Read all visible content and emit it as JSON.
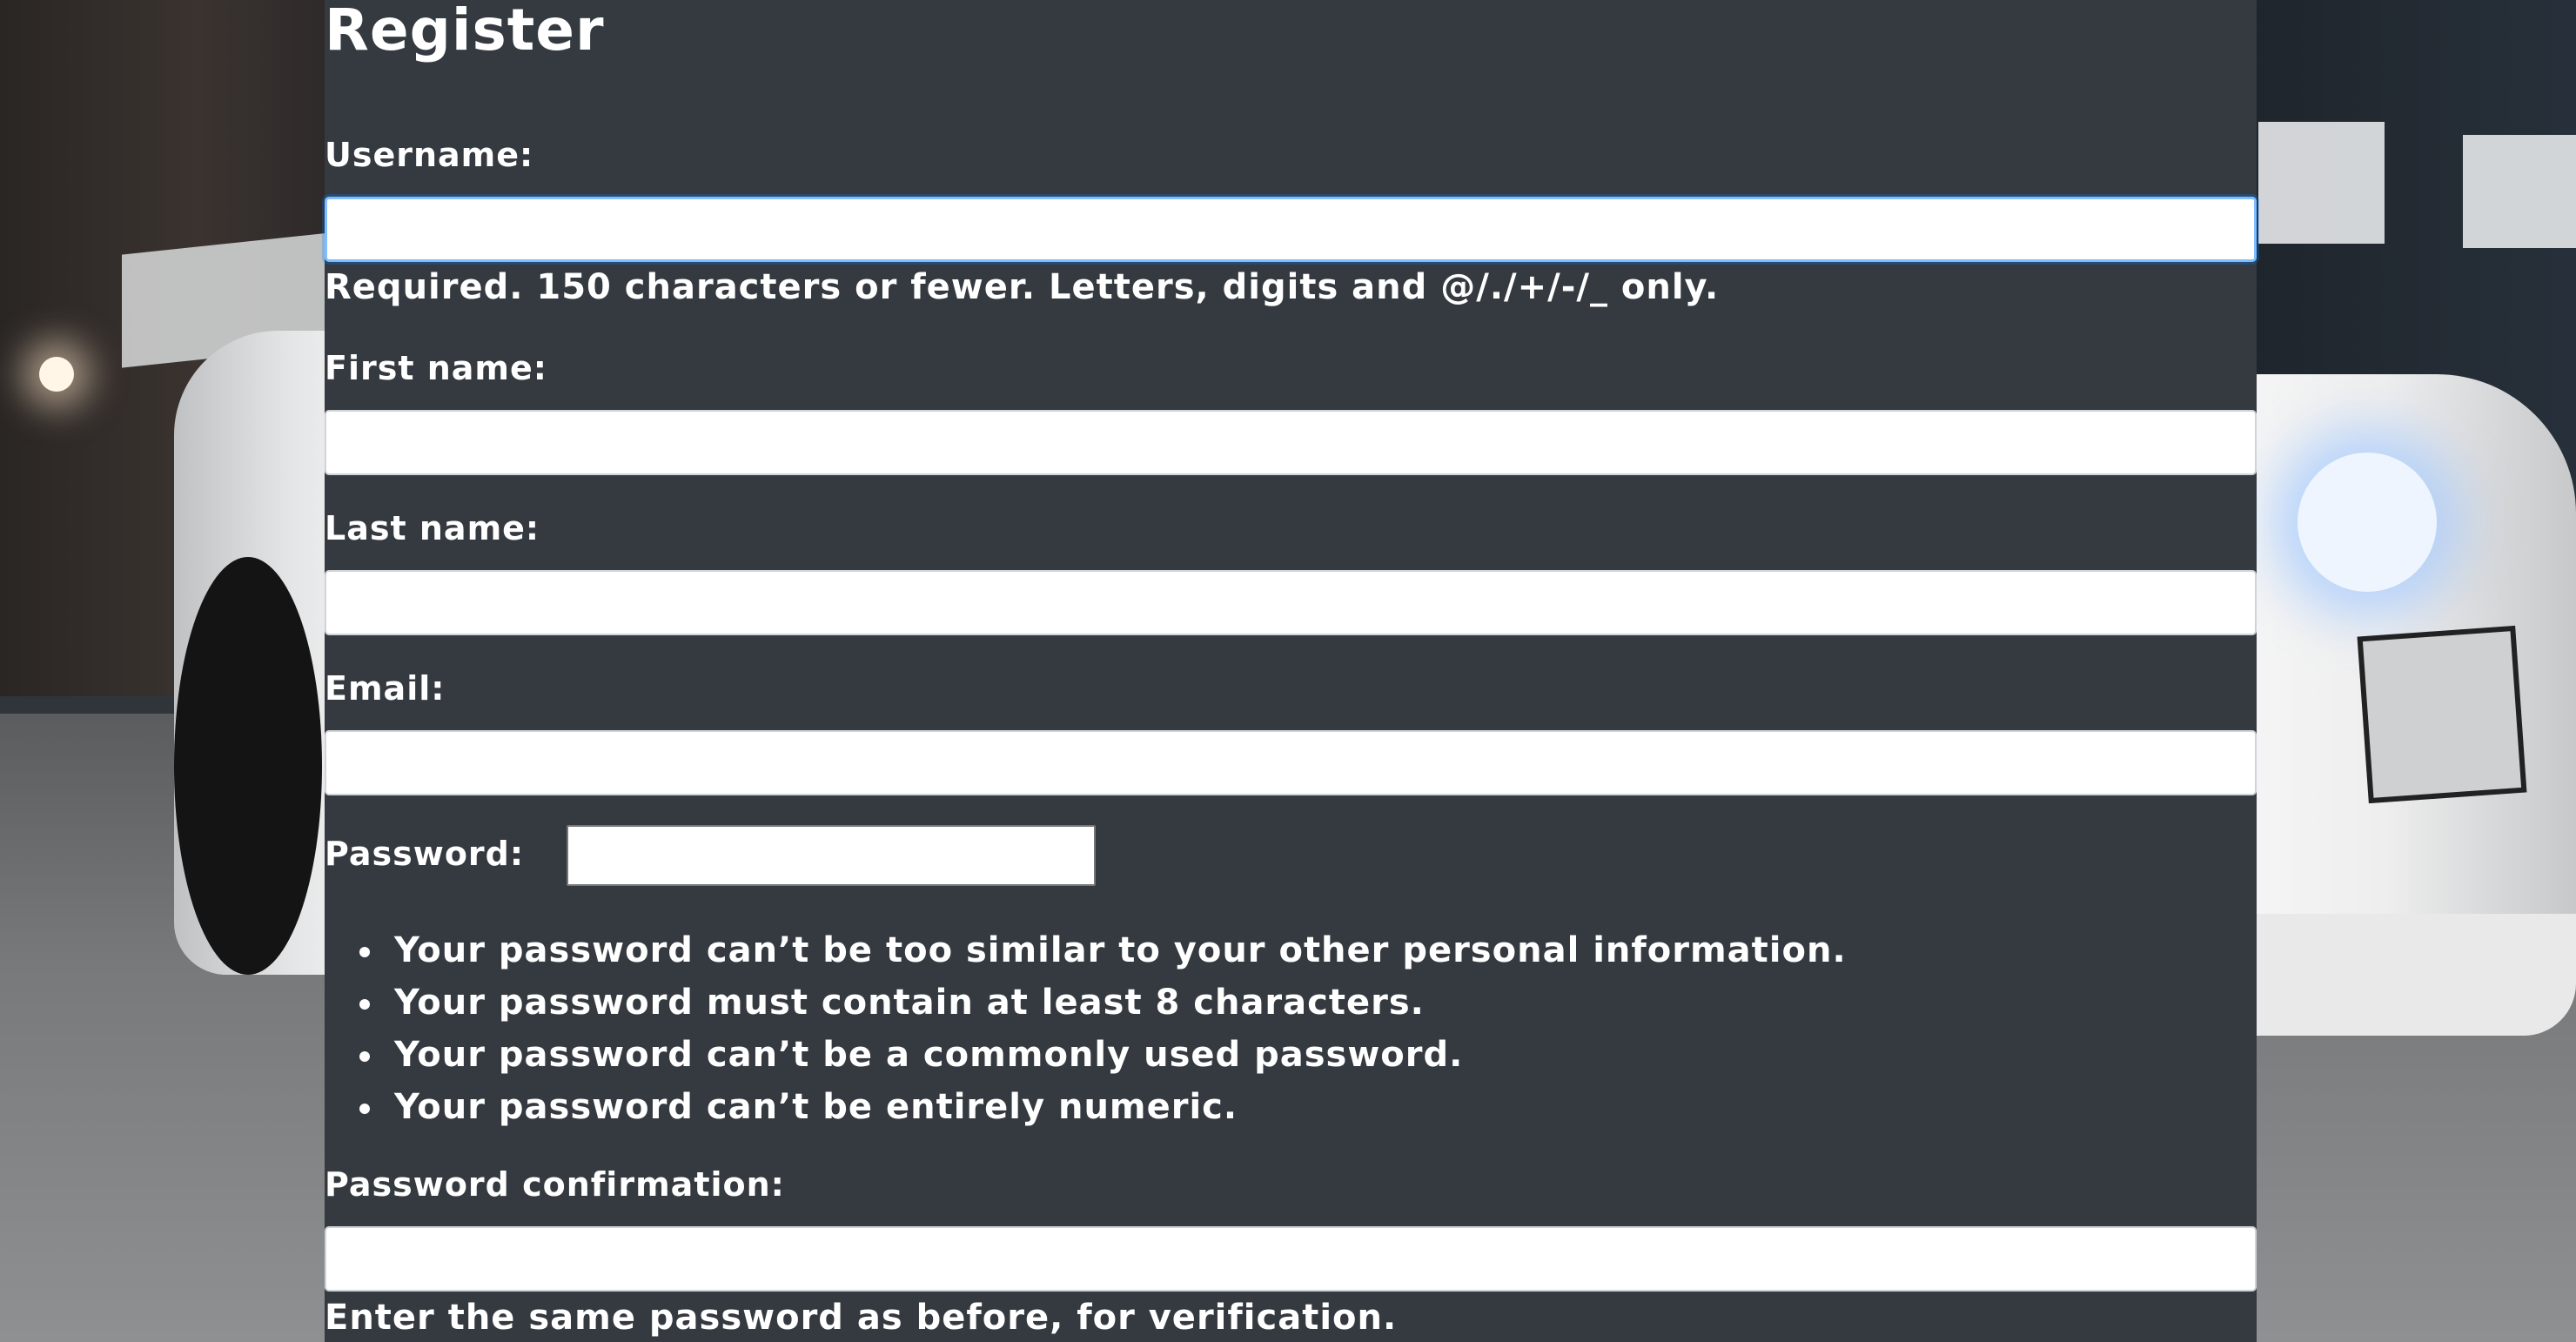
{
  "form": {
    "title": "Register",
    "username": {
      "label": "Username:",
      "value": "",
      "help": "Required. 150 characters or fewer. Letters, digits and @/./+/-/_ only."
    },
    "first_name": {
      "label": "First name:",
      "value": ""
    },
    "last_name": {
      "label": "Last name:",
      "value": ""
    },
    "email": {
      "label": "Email:",
      "value": ""
    },
    "password": {
      "label": "Password:",
      "value": "",
      "rules": [
        "Your password can’t be too similar to your other personal information.",
        "Your password must contain at least 8 characters.",
        "Your password can’t be a commonly used password.",
        "Your password can’t be entirely numeric."
      ]
    },
    "password_confirmation": {
      "label": "Password confirmation:",
      "value": "",
      "help": "Enter the same password as before, for verification."
    }
  },
  "colors": {
    "panel": "#343a40",
    "text": "#ffffff",
    "focus": "#80bdff"
  }
}
